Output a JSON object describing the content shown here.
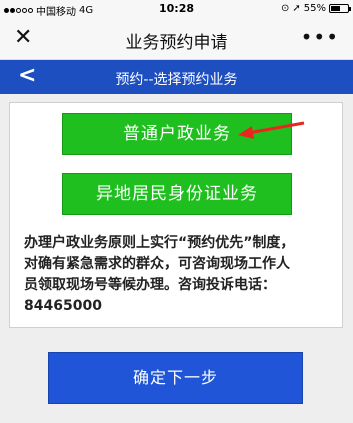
{
  "status_bar": {
    "carrier": "中国移动",
    "network": "4G",
    "time": "10:28",
    "battery": "55%"
  },
  "wx_nav": {
    "title": "业务预约申请",
    "close_icon": "close-icon",
    "more_icon": "more-icon"
  },
  "sub_header": {
    "title": "预约--选择预约业务"
  },
  "options": {
    "option_1": "普通户政业务",
    "option_2": "异地居民身份证业务"
  },
  "notice": {
    "line_1": "办理户政业务原则上实行“预约优先”制度，",
    "line_2": "对确有紧急需求的群众，可咨询现场工作人",
    "line_3": "员领取现场号等候办理。咨询投诉电话：",
    "line_4": "84465000"
  },
  "next_button": "确定下一步",
  "colors": {
    "blue_header": "#1e4fc0",
    "green_button": "#1fbf1f",
    "blue_button": "#1f55d6",
    "arrow_red": "#e8261e"
  }
}
